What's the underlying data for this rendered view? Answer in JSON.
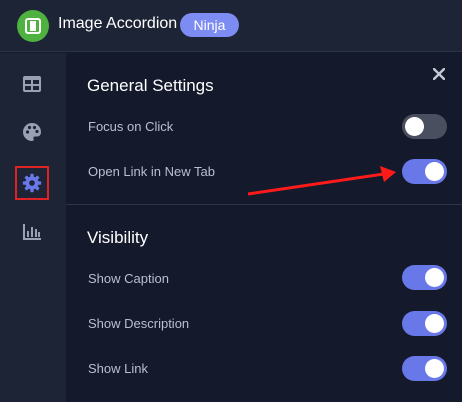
{
  "header": {
    "title": "Image Accordion",
    "badge": "Ninja"
  },
  "sidebar": {
    "items": [
      {
        "name": "layout",
        "icon": "table-icon",
        "active": false
      },
      {
        "name": "style",
        "icon": "palette-icon",
        "active": false
      },
      {
        "name": "settings",
        "icon": "gear-icon",
        "active": true
      },
      {
        "name": "analytics",
        "icon": "bar-chart-icon",
        "active": false
      }
    ]
  },
  "general_settings": {
    "title": "General Settings",
    "options": [
      {
        "label": "Focus on Click",
        "enabled": false
      },
      {
        "label": "Open Link in New Tab",
        "enabled": true
      }
    ]
  },
  "visibility": {
    "title": "Visibility",
    "options": [
      {
        "label": "Show Caption",
        "enabled": true
      },
      {
        "label": "Show Description",
        "enabled": true
      },
      {
        "label": "Show Link",
        "enabled": true
      }
    ]
  },
  "colors": {
    "accent": "#6878e8",
    "toggle_off": "#4a4f5f",
    "highlight": "#e02222",
    "logo": "#4fb13f"
  }
}
